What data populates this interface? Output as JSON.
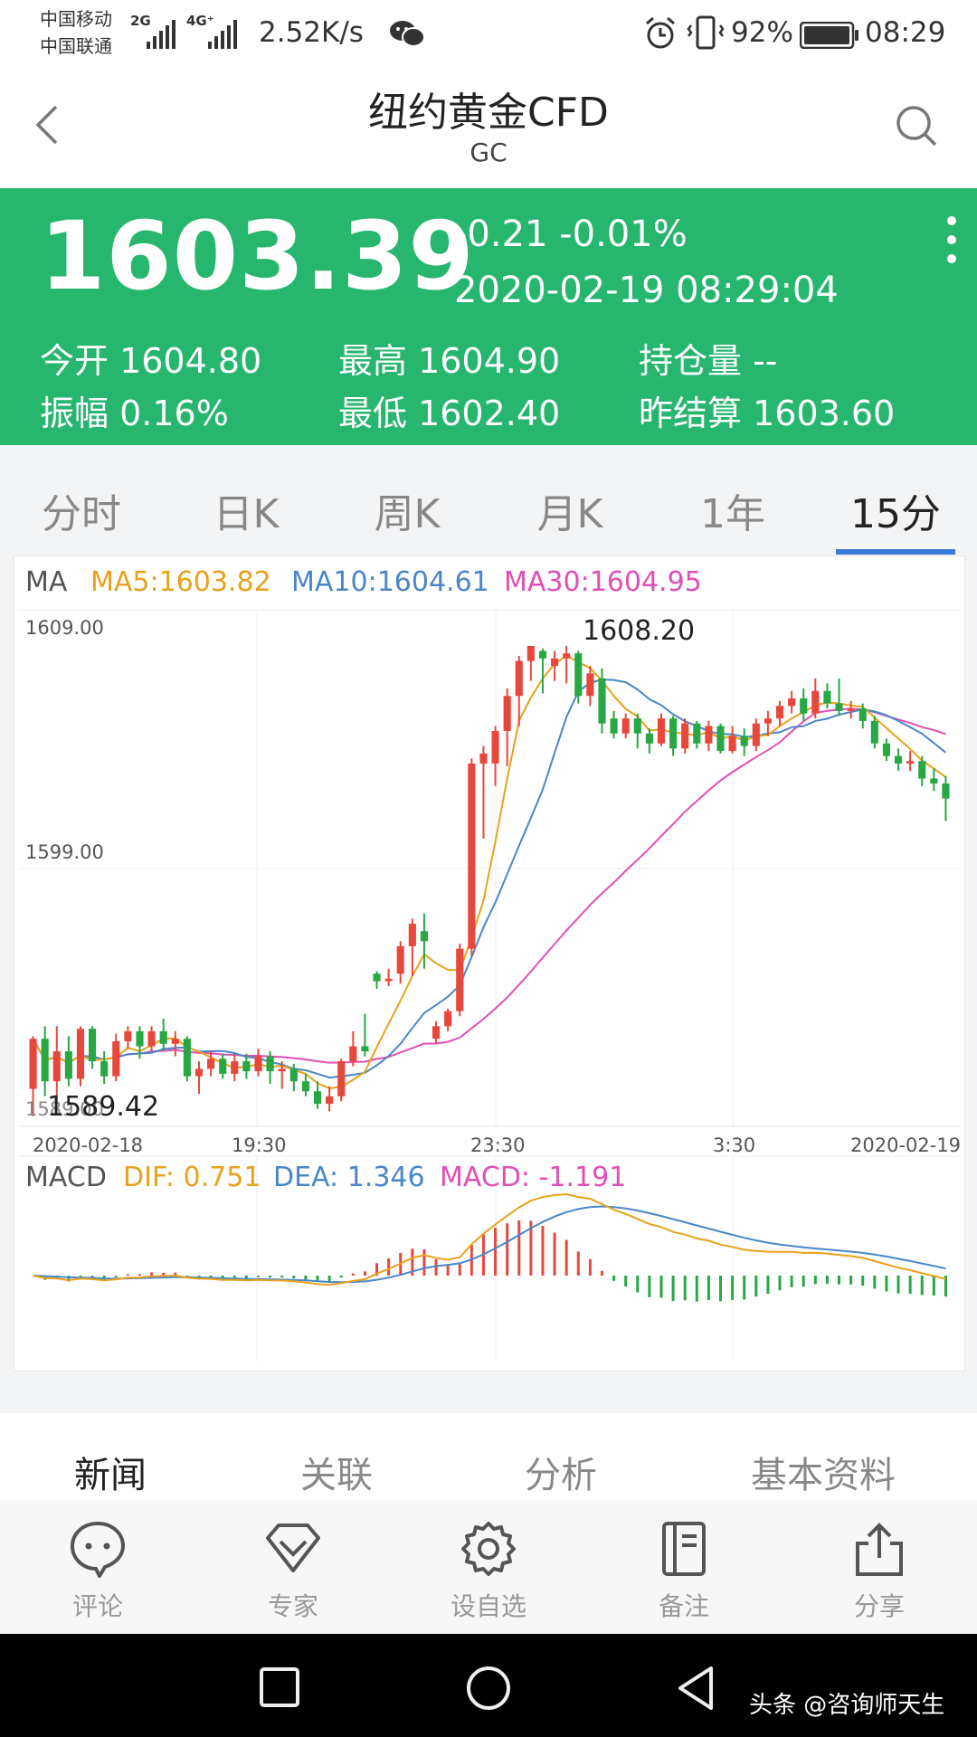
{
  "status_bar": {
    "carrier1": "中国移动",
    "carrier2": "中国联通",
    "net1": "2G",
    "net2": "4G⁺",
    "speed": "2.52K/s",
    "battery": "92%",
    "time": "08:29"
  },
  "header": {
    "title": "纽约黄金CFD",
    "subtitle": "GC"
  },
  "quote": {
    "price": "1603.39",
    "change": "-0.21 -0.01%",
    "datetime": "2020-02-19 08:29:04",
    "open": "今开 1604.80",
    "high": "最高 1604.90",
    "open_interest": "持仓量 --",
    "amplitude": "振幅 0.16%",
    "low": "最低 1602.40",
    "prev_settle": "昨结算 1603.60"
  },
  "period_tabs": [
    "分时",
    "日K",
    "周K",
    "月K",
    "1年",
    "15分"
  ],
  "active_period": "15分",
  "chart": {
    "ma_label": "MA",
    "ma5": "MA5:1603.82",
    "ma10": "MA10:1604.61",
    "ma30": "MA30:1604.95",
    "price_labels": {
      "top": "1609.00",
      "mid": "1599.00",
      "bottom": "1589.00"
    },
    "max_label": "1608.20",
    "min_label": "1589.42",
    "time_labels": [
      "2020-02-18",
      "19:30",
      "23:30",
      "3:30",
      "2020-02-19"
    ],
    "macd_label": "MACD",
    "dif": "DIF: 0.751",
    "dea": "DEA: 1.346",
    "macd": "MACD: -1.191",
    "colors": {
      "ma5": "#e8a21c",
      "ma10": "#4a86c8",
      "ma30": "#e04fb4",
      "up": "#e8483c",
      "down": "#28a745"
    }
  },
  "chart_data": {
    "type": "candlestick",
    "ylim": [
      1589,
      1609.5
    ],
    "x_ticks": [
      "2020-02-18",
      "19:30",
      "23:30",
      "3:30",
      "2020-02-19"
    ],
    "candles": [
      [
        1590.5,
        1592.5,
        1589.4,
        1592.6
      ],
      [
        1592.5,
        1590.8,
        1590.2,
        1593.0
      ],
      [
        1590.8,
        1592.0,
        1590.0,
        1593.0
      ],
      [
        1592.0,
        1590.9,
        1590.6,
        1592.6
      ],
      [
        1590.9,
        1592.9,
        1590.6,
        1593.0
      ],
      [
        1592.9,
        1591.6,
        1591.3,
        1593.0
      ],
      [
        1591.6,
        1591.0,
        1590.7,
        1592.0
      ],
      [
        1591.0,
        1592.4,
        1590.8,
        1592.7
      ],
      [
        1592.4,
        1592.8,
        1592.1,
        1593.0
      ],
      [
        1592.8,
        1592.2,
        1591.7,
        1593.0
      ],
      [
        1592.2,
        1592.8,
        1592.0,
        1593.0
      ],
      [
        1592.8,
        1592.3,
        1592.0,
        1593.3
      ],
      [
        1592.3,
        1592.5,
        1591.8,
        1592.8
      ],
      [
        1592.5,
        1591.0,
        1590.8,
        1592.6
      ],
      [
        1591.0,
        1591.3,
        1590.3,
        1591.6
      ],
      [
        1591.3,
        1591.7,
        1591.0,
        1592.0
      ],
      [
        1591.7,
        1591.1,
        1590.9,
        1591.9
      ],
      [
        1591.1,
        1591.6,
        1590.8,
        1591.9
      ],
      [
        1591.6,
        1591.2,
        1590.9,
        1591.9
      ],
      [
        1591.2,
        1591.8,
        1591.0,
        1592.1
      ],
      [
        1591.8,
        1591.2,
        1590.7,
        1592.0
      ],
      [
        1591.2,
        1591.3,
        1590.5,
        1591.6
      ],
      [
        1591.3,
        1590.8,
        1590.4,
        1591.5
      ],
      [
        1590.8,
        1590.4,
        1590.2,
        1591.1
      ],
      [
        1590.4,
        1589.9,
        1589.7,
        1590.8
      ],
      [
        1589.9,
        1590.2,
        1589.6,
        1590.6
      ],
      [
        1590.2,
        1591.6,
        1590.0,
        1591.7
      ],
      [
        1591.6,
        1592.2,
        1591.4,
        1592.8
      ],
      [
        1592.2,
        1592.0,
        1591.8,
        1593.5
      ],
      [
        1595.1,
        1594.8,
        1594.5,
        1595.2
      ],
      [
        1594.8,
        1594.9,
        1594.6,
        1595.3
      ],
      [
        1595.1,
        1596.2,
        1594.7,
        1596.4
      ],
      [
        1596.2,
        1597.1,
        1595.0,
        1597.3
      ],
      [
        1596.8,
        1596.4,
        1595.3,
        1597.5
      ],
      [
        1592.5,
        1593.0,
        1592.3,
        1593.2
      ],
      [
        1593.0,
        1593.6,
        1592.8,
        1593.7
      ],
      [
        1593.6,
        1596.1,
        1593.4,
        1596.3
      ],
      [
        1596.1,
        1603.5,
        1595.8,
        1603.7
      ],
      [
        1603.5,
        1603.9,
        1600.5,
        1604.2
      ],
      [
        1603.5,
        1604.8,
        1602.6,
        1605.0
      ],
      [
        1604.8,
        1606.2,
        1603.4,
        1606.5
      ],
      [
        1606.2,
        1607.6,
        1605.0,
        1607.8
      ],
      [
        1607.6,
        1608.2,
        1606.8,
        1608.2
      ],
      [
        1608.0,
        1607.7,
        1606.3,
        1608.1
      ],
      [
        1607.4,
        1607.7,
        1606.8,
        1608.0
      ],
      [
        1607.7,
        1607.9,
        1606.7,
        1608.2
      ],
      [
        1607.9,
        1606.2,
        1605.9,
        1608.0
      ],
      [
        1606.2,
        1607.1,
        1605.8,
        1607.4
      ],
      [
        1606.9,
        1605.1,
        1604.7,
        1607.3
      ],
      [
        1605.3,
        1604.7,
        1604.5,
        1605.6
      ],
      [
        1604.7,
        1605.3,
        1604.5,
        1605.5
      ],
      [
        1605.3,
        1604.7,
        1604.1,
        1605.5
      ],
      [
        1604.7,
        1604.3,
        1603.9,
        1604.9
      ],
      [
        1604.3,
        1605.3,
        1604.2,
        1605.5
      ],
      [
        1605.3,
        1604.1,
        1603.8,
        1605.4
      ],
      [
        1604.1,
        1605.1,
        1603.9,
        1605.3
      ],
      [
        1605.1,
        1604.3,
        1604.1,
        1605.2
      ],
      [
        1604.3,
        1605.0,
        1604.0,
        1605.2
      ],
      [
        1605.0,
        1604.0,
        1603.9,
        1605.1
      ],
      [
        1604.0,
        1604.6,
        1603.9,
        1605.0
      ],
      [
        1604.6,
        1604.2,
        1603.8,
        1604.9
      ],
      [
        1604.2,
        1605.1,
        1604.0,
        1605.3
      ],
      [
        1605.1,
        1605.3,
        1604.6,
        1605.6
      ],
      [
        1605.3,
        1605.8,
        1605.0,
        1606.0
      ],
      [
        1605.8,
        1606.1,
        1605.5,
        1606.4
      ],
      [
        1606.1,
        1605.5,
        1605.2,
        1606.5
      ],
      [
        1605.5,
        1606.4,
        1605.3,
        1606.9
      ],
      [
        1606.4,
        1605.9,
        1605.7,
        1606.7
      ],
      [
        1605.9,
        1605.6,
        1605.4,
        1606.9
      ],
      [
        1605.6,
        1605.7,
        1605.3,
        1606.0
      ],
      [
        1605.7,
        1605.2,
        1604.9,
        1605.9
      ],
      [
        1605.2,
        1604.3,
        1604.1,
        1605.4
      ],
      [
        1604.3,
        1603.8,
        1603.6,
        1604.5
      ],
      [
        1603.8,
        1603.5,
        1603.2,
        1604.1
      ],
      [
        1603.5,
        1603.6,
        1603.2,
        1604.0
      ],
      [
        1603.6,
        1602.9,
        1602.6,
        1603.8
      ],
      [
        1602.9,
        1602.7,
        1602.4,
        1603.3
      ],
      [
        1602.7,
        1602.1,
        1601.2,
        1603.0
      ]
    ],
    "ma5_end": 1603.82,
    "ma10_end": 1604.61,
    "ma30_end": 1604.95,
    "macd_end": {
      "dif": 0.751,
      "dea": 1.346,
      "macd": -1.191
    }
  },
  "info_tabs": [
    "新闻",
    "关联",
    "分析",
    "基本资料"
  ],
  "active_info_tab": "新闻",
  "toolbar": [
    {
      "label": "评论",
      "icon": "comment-icon"
    },
    {
      "label": "专家",
      "icon": "expert-icon"
    },
    {
      "label": "设自选",
      "icon": "settings-icon"
    },
    {
      "label": "备注",
      "icon": "notes-icon"
    },
    {
      "label": "分享",
      "icon": "share-icon"
    }
  ],
  "watermark": "头条 @咨询师天生"
}
